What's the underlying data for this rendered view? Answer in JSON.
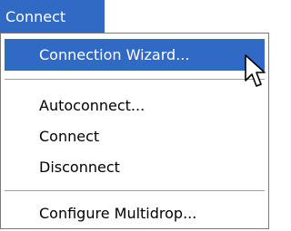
{
  "menubar": {
    "title": "Connect"
  },
  "menu": {
    "items": [
      {
        "label": "Connection Wizard...",
        "selected": true
      },
      {
        "label": "Autoconnect..."
      },
      {
        "label": "Connect"
      },
      {
        "label": "Disconnect"
      },
      {
        "label": "Configure Multidrop..."
      }
    ]
  },
  "colors": {
    "highlight": "#316ac5",
    "highlight_text": "#ffffff",
    "separator": "#a0a0a0",
    "border": "#7a7a7a"
  },
  "icons": {
    "cursor": "arrow-cursor-icon"
  }
}
